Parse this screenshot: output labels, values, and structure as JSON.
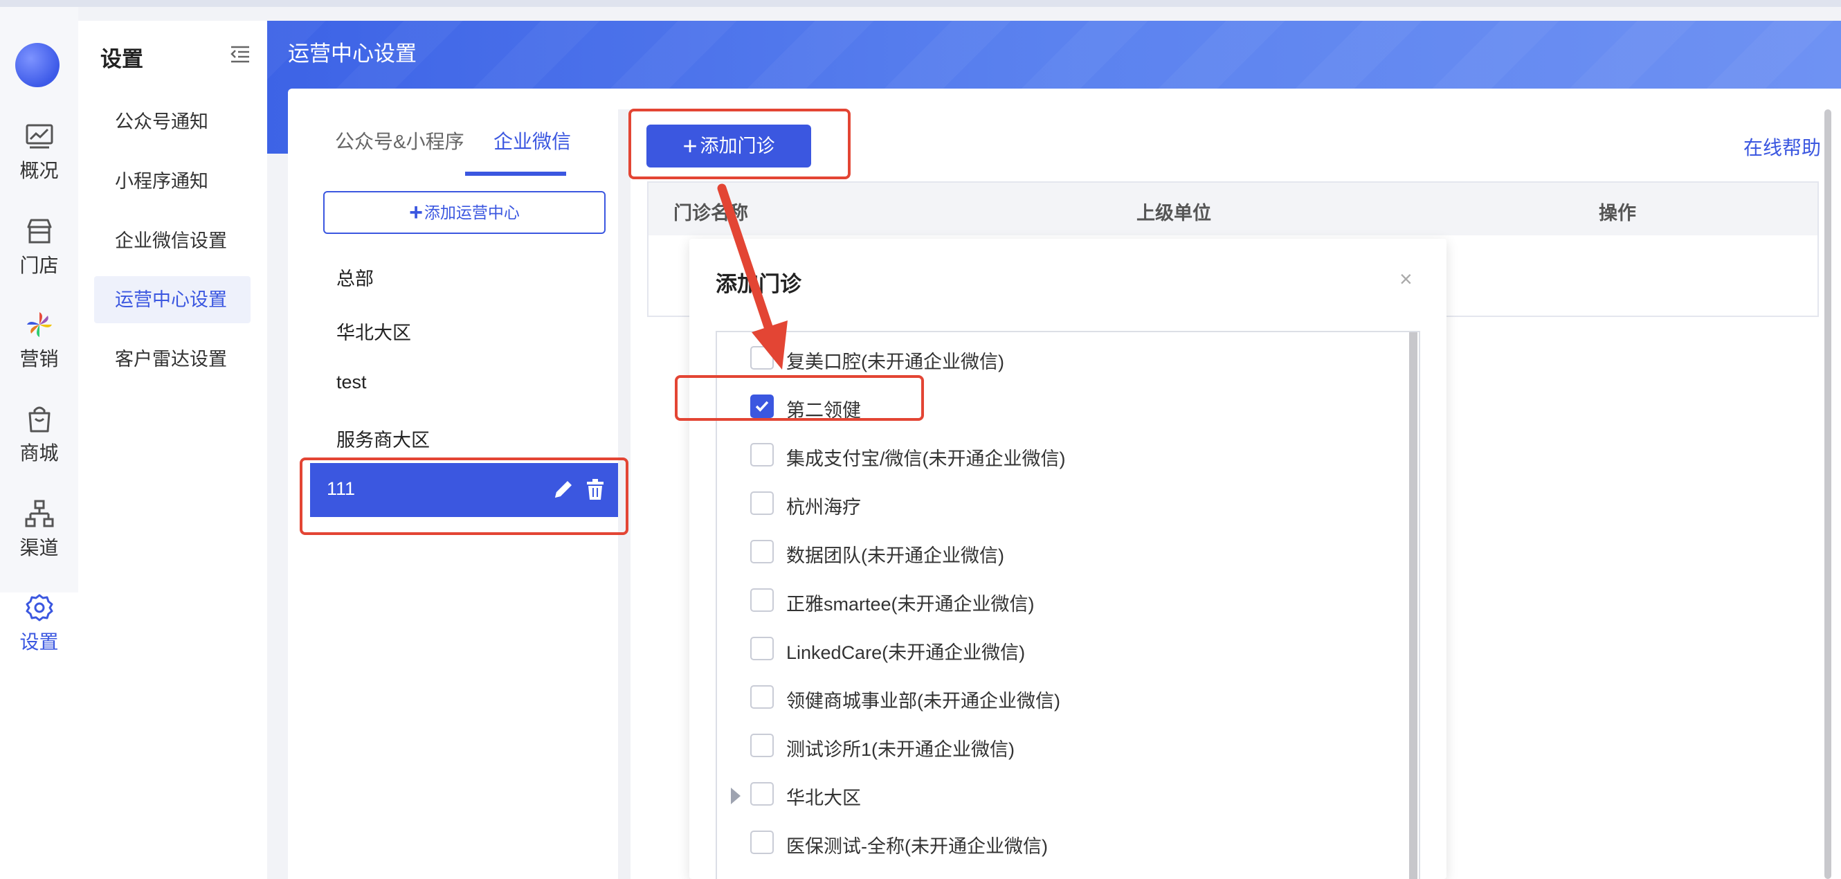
{
  "colors": {
    "accent": "#3b57e0",
    "annotation": "#e34534"
  },
  "rail": {
    "items": [
      {
        "label": "概况",
        "icon": "chart-line-icon"
      },
      {
        "label": "门店",
        "icon": "store-icon"
      },
      {
        "label": "营销",
        "icon": "pinwheel-icon"
      },
      {
        "label": "商城",
        "icon": "shopping-bag-icon"
      },
      {
        "label": "渠道",
        "icon": "org-chart-icon"
      },
      {
        "label": "设置",
        "icon": "gear-icon",
        "active": true
      }
    ]
  },
  "submenu": {
    "title": "设置",
    "items": [
      {
        "label": "公众号通知"
      },
      {
        "label": "小程序通知"
      },
      {
        "label": "企业微信设置"
      },
      {
        "label": "运营中心设置",
        "active": true
      },
      {
        "label": "客户雷达设置"
      }
    ]
  },
  "header": {
    "title": "运营中心设置"
  },
  "tabs": [
    {
      "label": "公众号&小程序"
    },
    {
      "label": "企业微信",
      "active": true
    }
  ],
  "centers": {
    "add_label": "添加运营中心",
    "items": [
      "总部",
      "华北大区",
      "test",
      "服务商大区"
    ],
    "selected": "111"
  },
  "clinic": {
    "add_label": "添加门诊",
    "help_label": "在线帮助",
    "columns": [
      "门诊名称",
      "上级单位",
      "操作"
    ]
  },
  "modal": {
    "title": "添加门诊",
    "close": "×",
    "options": [
      {
        "label": "复美口腔(未开通企业微信)",
        "checked": false
      },
      {
        "label": "第二领健",
        "checked": true
      },
      {
        "label": "集成支付宝/微信(未开通企业微信)",
        "checked": false
      },
      {
        "label": "杭州海疗",
        "checked": false
      },
      {
        "label": "数据团队(未开通企业微信)",
        "checked": false
      },
      {
        "label": "正雅smartee(未开通企业微信)",
        "checked": false
      },
      {
        "label": "LinkedCare(未开通企业微信)",
        "checked": false
      },
      {
        "label": "领健商城事业部(未开通企业微信)",
        "checked": false
      },
      {
        "label": "测试诊所1(未开通企业微信)",
        "checked": false
      },
      {
        "label": "华北大区",
        "checked": false,
        "expandable": true
      },
      {
        "label": "医保测试-全称(未开通企业微信)",
        "checked": false
      }
    ]
  }
}
